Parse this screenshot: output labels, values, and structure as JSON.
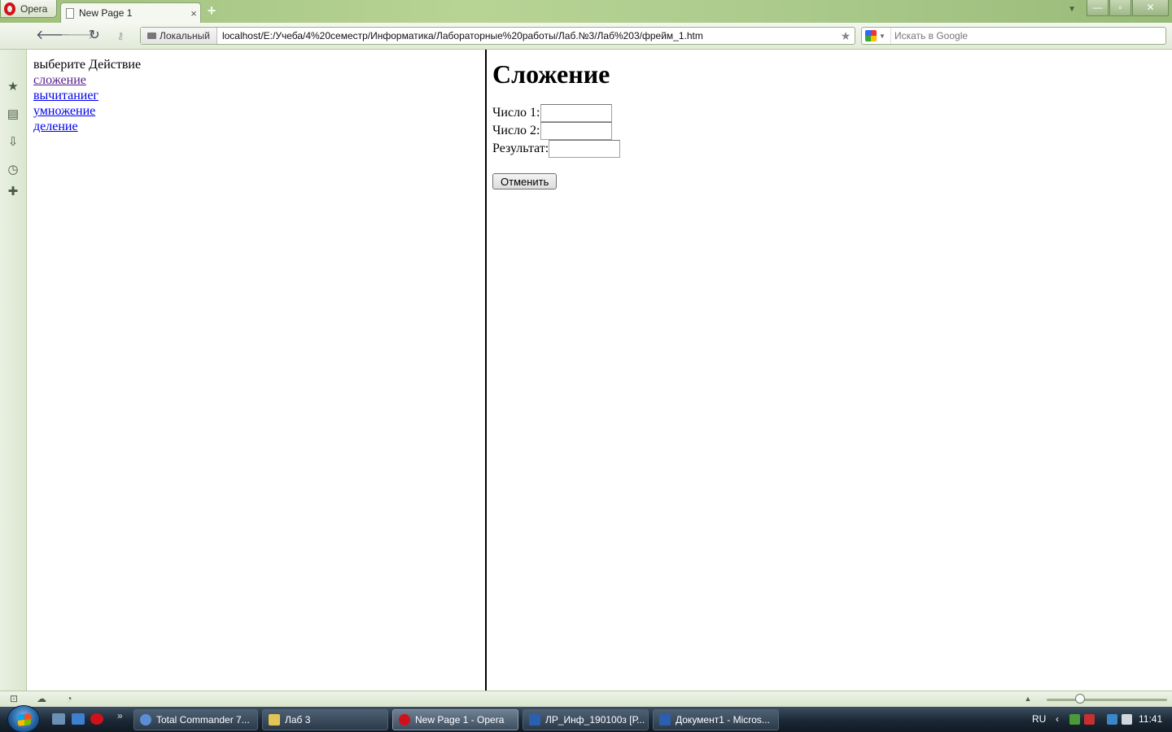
{
  "browser": {
    "menu_label": "Opera",
    "tab": {
      "title": "New Page 1",
      "close_glyph": "×"
    },
    "new_tab_glyph": "+",
    "window_controls": {
      "minimize": "—",
      "maximize": "▫",
      "close": "✕"
    },
    "address": {
      "badge": "Локальный",
      "url": "localhost/E:/Учеба/4%20семестр/Информатика/Лабораторные%20работы/Лаб.№3/Лаб%203/фрейм_1.htm"
    },
    "search": {
      "placeholder": "Искать в Google"
    },
    "icons": {
      "back": "back-arrow-icon",
      "forward": "forward-arrow-icon",
      "reload": "reload-icon",
      "wand": "wand-key-icon",
      "bookmark": "star-icon",
      "google": "google-icon"
    }
  },
  "sidepanel": {
    "icons": [
      "star-icon",
      "notes-icon",
      "downloads-icon",
      "history-icon",
      "add-panel-icon"
    ]
  },
  "left_frame": {
    "prompt": "выберите Действие",
    "links": [
      {
        "label": "сложение",
        "visited": true
      },
      {
        "label": "вычитаниег",
        "visited": false
      },
      {
        "label": "умножение",
        "visited": false
      },
      {
        "label": "деление",
        "visited": false
      }
    ]
  },
  "right_frame": {
    "heading": "Сложение",
    "fields": [
      {
        "label": "Число 1:",
        "value": ""
      },
      {
        "label": "Число 2:",
        "value": ""
      },
      {
        "label": "Результат:",
        "value": ""
      }
    ],
    "cancel_button": "Отменить"
  },
  "statusbar": {
    "icons": [
      "panel-toggle-icon",
      "unite-cloud-icon",
      "turbo-icon",
      "view-up-icon",
      "zoom-slider"
    ]
  },
  "taskbar": {
    "tasks": [
      {
        "label": "Total Commander 7...",
        "active": false,
        "icon_color": "#5a8fd6"
      },
      {
        "label": "Лаб 3",
        "active": false,
        "icon_color": "#e3c455"
      },
      {
        "label": "New Page 1 - Opera",
        "active": true,
        "icon_color": "#d0111c"
      },
      {
        "label": "ЛР_Инф_190100з [Р...",
        "active": false,
        "icon_color": "#2b5fb0"
      },
      {
        "label": "Документ1 - Micros...",
        "active": false,
        "icon_color": "#2b5fb0"
      }
    ],
    "language": "RU",
    "clock": "11:41",
    "quick_launch_chevron": "»"
  },
  "colors": {
    "link": "#0000ee",
    "visited_link": "#551a8b",
    "chrome_green": "#b8d495",
    "taskbar": "#1b2835"
  }
}
